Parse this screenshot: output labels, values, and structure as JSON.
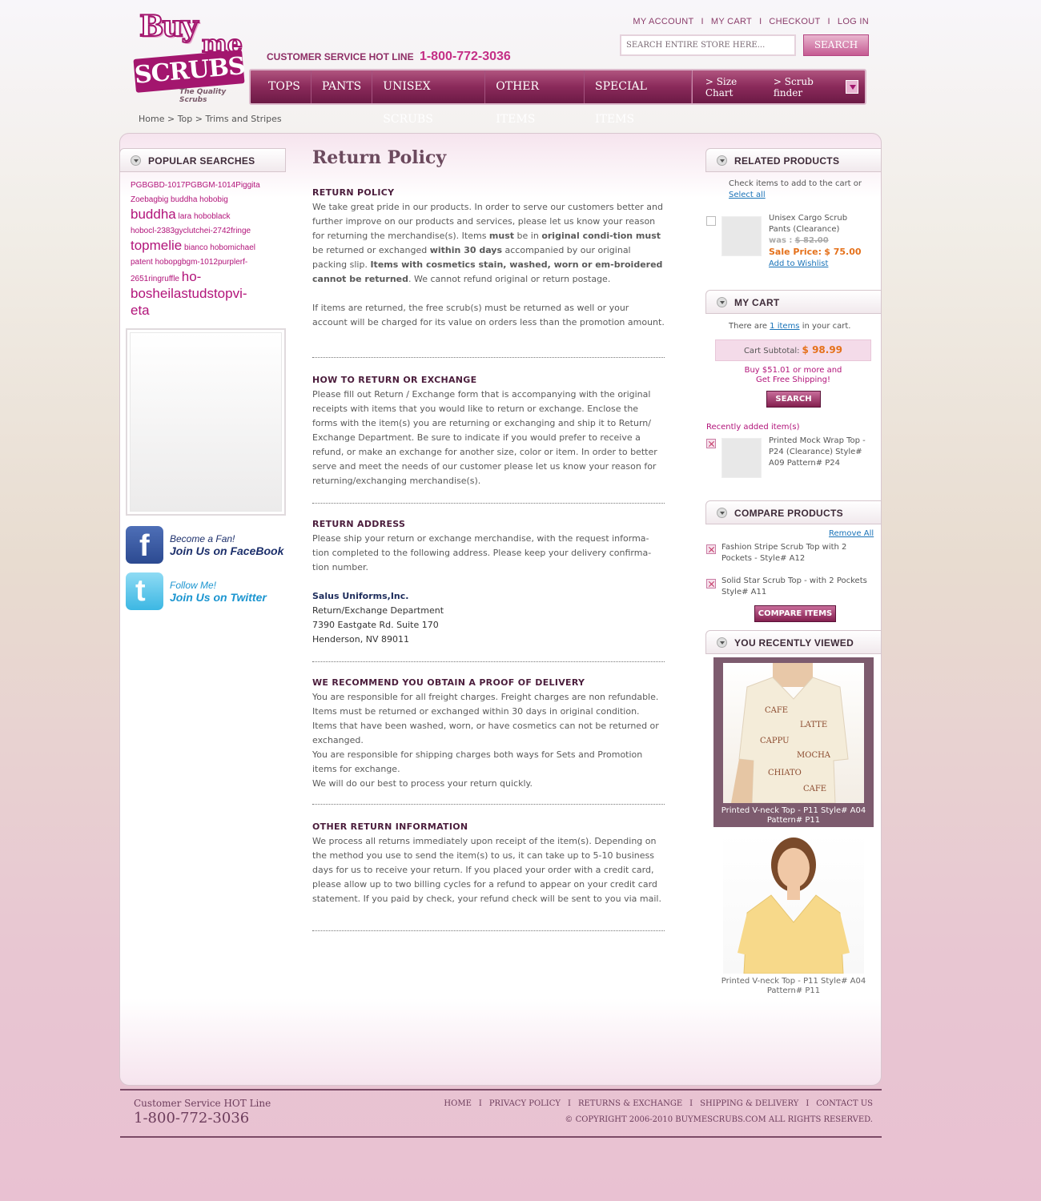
{
  "brand": {
    "logo_top": "Buy",
    "logo_me": "me",
    "logo_main": "SCRUBS",
    "tagline": "The Quality Scrubs"
  },
  "header": {
    "hotline_label": "CUSTOMER SERVICE  HOT LINE",
    "hotline_number": "1-800-772-3036",
    "toplinks": [
      "MY ACCOUNT",
      "MY CART",
      "CHECKOUT",
      "LOG IN"
    ],
    "search_placeholder": "SEARCH ENTIRE STORE HERE...",
    "search_button": "SEARCH"
  },
  "nav": {
    "items": [
      "TOPS",
      "PANTS",
      "UNISEX SCRUBS",
      "OTHER ITEMS",
      "SPECIAL ITEMS"
    ],
    "size_chart": "> Size Chart",
    "scrub_finder": "> Scrub finder"
  },
  "breadcrumb": "Home > Top > Trims and Stripes",
  "left": {
    "popular_title": "POPULAR SEARCHES",
    "tags": {
      "t1": "PGBGBD-1017PGBGM-1014Piggita",
      "t2": "Zoebagbig buddha hobobig",
      "t3": "buddha",
      "t4": "lara hoboblack",
      "t5": "hobocl-2383gyclutchei-2742fringe",
      "t6": "topmelie",
      "t7": "bianco hobomichael",
      "t8": "patent hobopgbgm-1012purplerf-",
      "t9": "2651ringruffle",
      "t10": "ho-",
      "t11": "bosheilastudstopvi-",
      "t12": "eta"
    },
    "fb_l1": "Become a Fan!",
    "fb_l2": "Join Us on FaceBook",
    "tw_l1": "Follow Me!",
    "tw_l2": "Join Us on Twitter"
  },
  "content": {
    "title": "Return Policy",
    "s1_head": "RETURN POLICY",
    "s1_a": "We take great pride in our products. In order to serve our customers better and further improve on our products and services, please let us know your reason for returning the merchandise(s). Items ",
    "s1_b": "must",
    "s1_c": " be in ",
    "s1_d": "original condi-tion must",
    "s1_e": " be returned or exchanged ",
    "s1_f": "within 30 days",
    "s1_g": " accompanied by our original packing slip. ",
    "s1_h": "Items with cosmetics stain, washed, worn or em-broidered cannot be returned",
    "s1_i": ". We cannot refund original or return postage.",
    "s1_p2": "If items are returned, the free scrub(s) must be returned as well or your account will be charged for its value on orders less than the promotion amount.",
    "s2_head": "HOW TO RETURN OR EXCHANGE",
    "s2_body": "Please fill out Return / Exchange form that is accompanying with the original receipts with items that you would like to return or exchange. Enclose the forms with the item(s) you are returning or exchanging and ship it to Return/ Exchange Department. Be sure to indicate if you would prefer to receive a refund, or make an exchange for another size, color or item. In order to better serve and meet the needs of our customer please let us know your reason for returning/exchanging merchandise(s).",
    "s3_head": "RETURN ADDRESS",
    "s3_body": "Please ship your return or exchange merchandise, with the request informa-tion completed to the following address. Please keep your delivery confirma-tion number.",
    "addr_co": "Salus Uniforms,Inc.",
    "addr_l1": "Return/Exchange Department",
    "addr_l2": "7390 Eastgate Rd. Suite 170",
    "addr_l3": "Henderson, NV 89011",
    "s4_head": "WE RECOMMEND YOU OBTAIN A PROOF OF DELIVERY",
    "s4_p1": "You are responsible for all freight charges. Freight charges are non refundable. Items must be returned or exchanged within 30 days in original condition. Items that have been washed, worn, or have cosmetics can not be returned or exchanged.",
    "s4_p2": "You are responsible for shipping charges both ways for Sets and Promotion items for exchange.",
    "s4_p3": "We will do our best to process your return quickly.",
    "s5_head": "OTHER RETURN INFORMATION",
    "s5_body": "We process all returns immediately upon receipt of the item(s). Depending on the method you use to send the item(s) to us, it can take up to 5-10 business days for us to receive your return. If you placed your order with a credit card, please allow up to two billing cycles for a refund to appear on your credit card statement. If you paid by check, your refund check will be sent to you via mail."
  },
  "right": {
    "related_title": "RELATED PRODUCTS",
    "related_intro": "Check items to add to the cart or",
    "select_all": "Select all",
    "rel_name": "Unisex Cargo Scrub Pants (Clearance)",
    "rel_was_label": "was :",
    "rel_was": "$ 82.00",
    "rel_sale_label": "Sale Price:",
    "rel_sale": "$ 75.00",
    "rel_wishlist": "Add to Wishlist",
    "cart_title": "MY CART",
    "cart_pre": "There are ",
    "cart_items": "1 items",
    "cart_post": " in your cart.",
    "subtotal_label": "Cart Subtotal:",
    "subtotal": "$ 98.99",
    "free_l1": "Buy $51.01 or more and",
    "free_l2": "Get Free Shipping!",
    "cart_button": "SEARCH",
    "recent_head": "Recently added item(s)",
    "recent_item": "Printed Mock Wrap Top - P24 (Clearance) Style# A09 Pattern# P24",
    "compare_title": "COMPARE PRODUCTS",
    "remove_all": "Remove All",
    "cmp1": "Fashion Stripe Scrub Top with 2 Pockets - Style# A12",
    "cmp2": "Solid Star Scrub Top - with 2 Pockets Style# A11",
    "compare_button": "COMPARE ITEMS",
    "viewed_title": "YOU RECENTLY VIEWED",
    "viewed1": "Printed V-neck Top - P11 Style# A04 Pattern# P11",
    "viewed2": "Printed V-neck Top - P11 Style# A04 Pattern# P11"
  },
  "footer": {
    "cs": "Customer Service  HOT Line",
    "number": "1-800-772-3036",
    "links": [
      "HOME",
      "PRIVACY POLICY",
      "RETURNS & EXCHANGE",
      "SHIPPING & DELIVERY",
      "CONTACT US"
    ],
    "copyright": "© COPYRIGHT 2006-2010 BUYMESCRUBS.COM ALL RIGHTS RESERVED."
  },
  "colors": {
    "brand_magenta": "#a3166e",
    "nav_plum": "#8a2a5a",
    "sale_orange": "#e5711b",
    "link_blue": "#1a73b8"
  }
}
